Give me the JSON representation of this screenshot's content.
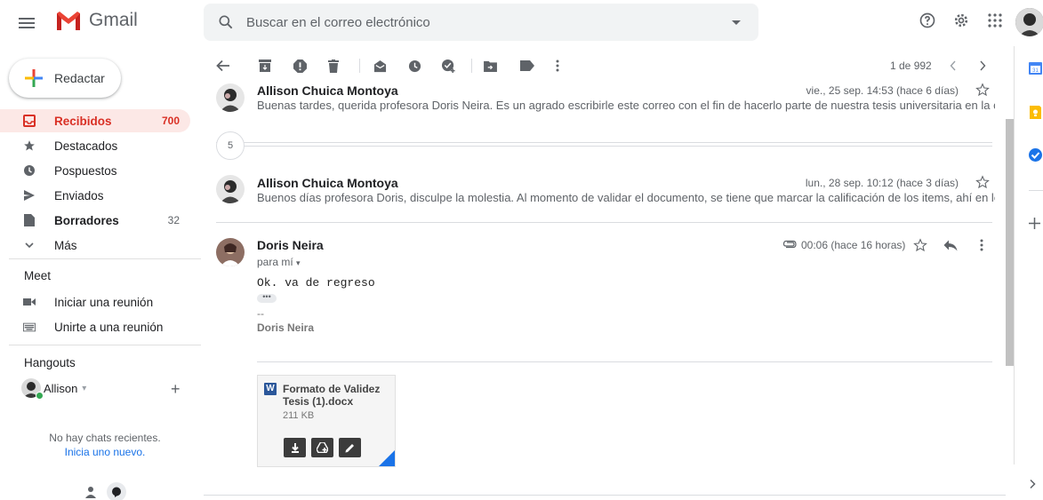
{
  "app": {
    "name": "Gmail"
  },
  "search": {
    "placeholder": "Buscar en el correo electrónico"
  },
  "compose": {
    "label": "Redactar"
  },
  "nav": [
    {
      "label": "Recibidos",
      "count": "700",
      "icon": "inbox-icon",
      "active": true
    },
    {
      "label": "Destacados",
      "count": "",
      "icon": "star-icon"
    },
    {
      "label": "Pospuestos",
      "count": "",
      "icon": "clock-icon"
    },
    {
      "label": "Enviados",
      "count": "",
      "icon": "send-icon"
    },
    {
      "label": "Borradores",
      "count": "32",
      "icon": "draft-icon"
    },
    {
      "label": "Más",
      "count": "",
      "icon": "chevron-down-icon"
    }
  ],
  "meet": {
    "title": "Meet",
    "items": [
      {
        "label": "Iniciar una reunión",
        "icon": "video-icon"
      },
      {
        "label": "Unirte a una reunión",
        "icon": "keyboard-icon"
      }
    ]
  },
  "hangouts": {
    "title": "Hangouts",
    "user": "Allison",
    "no_chats": "No hay chats recientes.",
    "start_new": "Inicia uno nuevo."
  },
  "toolbar": {
    "pager": "1 de 992"
  },
  "thread": {
    "messages": [
      {
        "sender": "Allison Chuica Montoya",
        "date": "vie., 25 sep. 14:53 (hace 6 días)",
        "snippet": "Buenas tardes, querida profesora Doris Neira. Es un agrado escribirle este correo con el fin de hacerlo parte de nuestra tesis universitaria en la carrera de Co"
      },
      {
        "sender": "Allison Chuica Montoya",
        "date": "lun., 28 sep. 10:12 (hace 3 días)",
        "snippet": "Buenos días profesora Doris, disculpe la molestia. Al momento de validar el documento, se tiene que marcar la calificación de los items, ahí en los cuadros hay"
      }
    ],
    "collapsed_count": "5",
    "open_message": {
      "sender": "Doris Neira",
      "to": "para mí",
      "date": "00:06 (hace 16 horas)",
      "body": "Ok. va de regreso",
      "ellipsis": "•••",
      "sig_dash": "--",
      "sig_name": "Doris Neira",
      "attachment": {
        "badge": "W",
        "name": "Formato de Validez Tesis (1).docx",
        "size": "211 KB"
      }
    }
  },
  "colors": {
    "accent_red": "#d93025",
    "active_bg": "#fce8e6",
    "link_blue": "#1a73e8"
  }
}
